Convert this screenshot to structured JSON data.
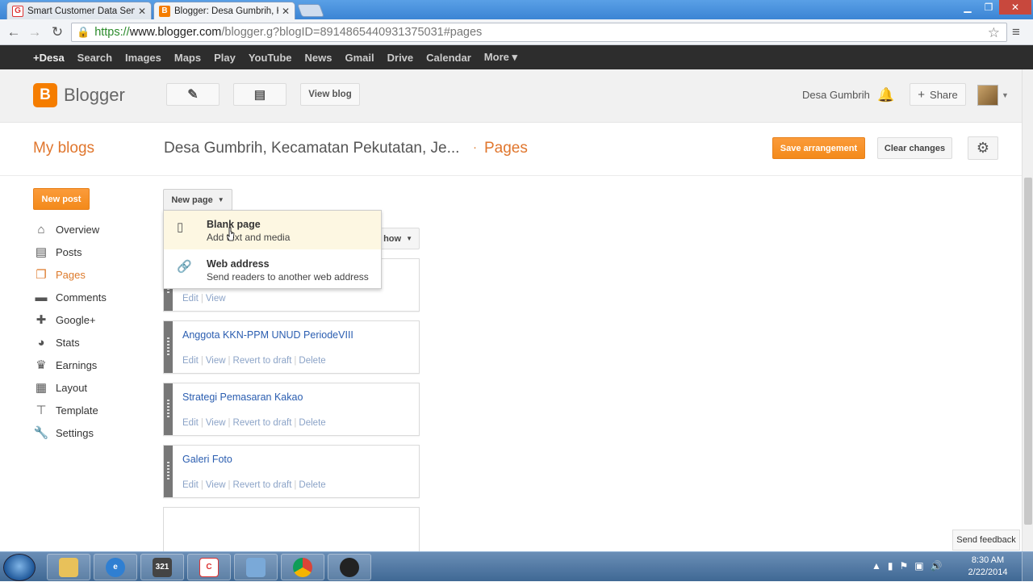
{
  "browser": {
    "tabs": [
      {
        "label": "Smart Customer Data Serv",
        "favicon": "G"
      },
      {
        "label": "Blogger: Desa Gumbrih, Ke",
        "favicon": "B"
      }
    ],
    "url": {
      "protocol": "https://",
      "host": "www.blogger.com",
      "path": "/blogger.g?blogID=8914865440931375031#pages"
    }
  },
  "gbar": {
    "items": [
      "+Desa",
      "Search",
      "Images",
      "Maps",
      "Play",
      "YouTube",
      "News",
      "Gmail",
      "Drive",
      "Calendar",
      "More ▾"
    ]
  },
  "header": {
    "brand": "Blogger",
    "view_blog": "View blog",
    "username": "Desa Gumbrih",
    "share": "Share"
  },
  "subheader": {
    "my_blogs": "My blogs",
    "blog_title": "Desa Gumbrih, Kecamatan Pekutatan, Je...",
    "separator": "·",
    "section": "Pages",
    "save": "Save arrangement",
    "clear": "Clear changes"
  },
  "sidebar": {
    "new_post": "New post",
    "items": [
      {
        "label": "Overview",
        "icon": "home-icon"
      },
      {
        "label": "Posts",
        "icon": "posts-icon"
      },
      {
        "label": "Pages",
        "icon": "pages-icon",
        "active": true
      },
      {
        "label": "Comments",
        "icon": "comments-icon"
      },
      {
        "label": "Google+",
        "icon": "google-plus-icon"
      },
      {
        "label": "Stats",
        "icon": "stats-icon"
      },
      {
        "label": "Earnings",
        "icon": "trophy-icon"
      },
      {
        "label": "Layout",
        "icon": "layout-icon"
      },
      {
        "label": "Template",
        "icon": "template-icon"
      },
      {
        "label": "Settings",
        "icon": "wrench-icon"
      }
    ]
  },
  "main": {
    "new_page": "New page",
    "show": "how",
    "dropdown": [
      {
        "title": "Blank page",
        "desc": "Add text and media"
      },
      {
        "title": "Web address",
        "desc": "Send readers to another web address"
      }
    ],
    "pages": [
      {
        "title": "",
        "actions": [
          "Edit",
          "View"
        ]
      },
      {
        "title": "Anggota KKN-PPM UNUD PeriodeVIII",
        "actions": [
          "Edit",
          "View",
          "Revert to draft",
          "Delete"
        ]
      },
      {
        "title": "Strategi Pemasaran Kakao",
        "actions": [
          "Edit",
          "View",
          "Revert to draft",
          "Delete"
        ]
      },
      {
        "title": "Galeri Foto",
        "actions": [
          "Edit",
          "View",
          "Revert to draft",
          "Delete"
        ]
      }
    ]
  },
  "feedback": "Send feedback",
  "taskbar": {
    "time": "8:30 AM",
    "date": "2/22/2014"
  },
  "colors": {
    "accent": "#f38a1b",
    "link": "#2a5db0",
    "gbar": "#2d2d2d"
  }
}
